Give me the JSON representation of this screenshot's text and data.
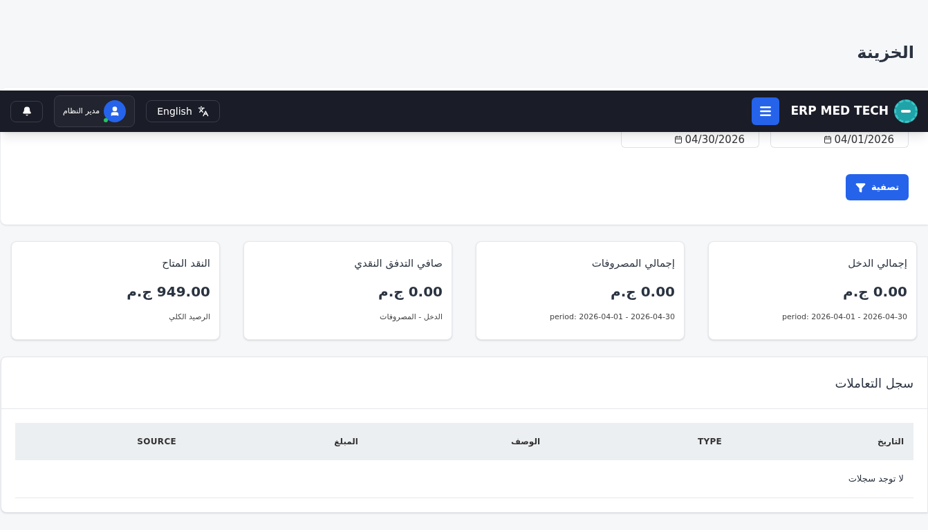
{
  "page_title": "الخزينة",
  "navbar": {
    "brand": "ERP MED TECH",
    "language_button": "English",
    "user": {
      "name": "مدير النظام",
      "online": true
    }
  },
  "filter": {
    "dates": [
      {
        "value": "04/01/2026"
      },
      {
        "value": "04/30/2026"
      }
    ],
    "button": "تصفية"
  },
  "stats": [
    {
      "title": "إجمالي الدخل",
      "value": "0.00 ج.م",
      "note": "period: 2026-04-01 - 2026-04-30"
    },
    {
      "title": "إجمالي المصروفات",
      "value": "0.00 ج.م",
      "note": "period: 2026-04-01 - 2026-04-30"
    },
    {
      "title": "صافي التدفق النقدي",
      "value": "0.00 ج.م",
      "note": "الدخل - المصروفات"
    },
    {
      "title": "النقد المتاح",
      "value": "949.00 ج.م",
      "note": "الرصيد الكلي"
    }
  ],
  "transactions": {
    "title": "سجل التعاملات",
    "columns": [
      "التاريخ",
      "TYPE",
      "الوصف",
      "المبلغ",
      "SOURCE"
    ],
    "empty_message": "لا توجد سجلات"
  }
}
